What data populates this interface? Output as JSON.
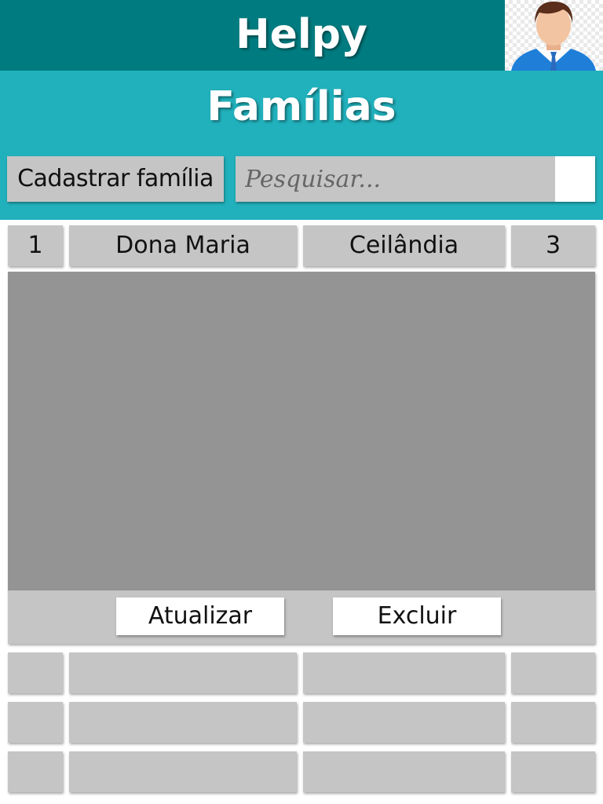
{
  "app": {
    "title": "Helpy"
  },
  "page": {
    "title": "Famílias"
  },
  "toolbar": {
    "register_label": "Cadastrar família",
    "search_placeholder": "Pesquisar..."
  },
  "families": {
    "rows": [
      {
        "id": "1",
        "name": "Dona Maria",
        "region": "Ceilândia",
        "members": "3",
        "expanded": true
      },
      {
        "id": "",
        "name": "",
        "region": "",
        "members": ""
      },
      {
        "id": "",
        "name": "",
        "region": "",
        "members": ""
      },
      {
        "id": "",
        "name": "",
        "region": "",
        "members": ""
      }
    ]
  },
  "actions": {
    "update_label": "Atualizar",
    "delete_label": "Excluir"
  },
  "colors": {
    "topbar": "#007c80",
    "header": "#21b1bc",
    "cell": "#c5c5c5",
    "panel": "#949494"
  },
  "icons": {
    "avatar": "user-avatar-icon",
    "search": "search-icon"
  }
}
